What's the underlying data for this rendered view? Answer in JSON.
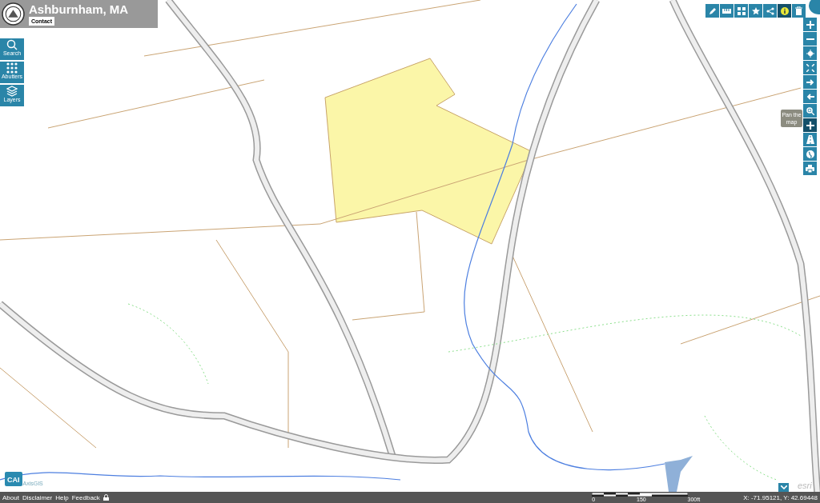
{
  "header": {
    "title": "Ashburnham, MA",
    "contact_button": "Contact"
  },
  "left_tools": [
    {
      "kind": "search",
      "label": "Search"
    },
    {
      "kind": "abutters",
      "label": "Abutters"
    },
    {
      "kind": "layers",
      "label": "Layers"
    }
  ],
  "top_tools": [
    {
      "kind": "pencil",
      "selected": false
    },
    {
      "kind": "ruler",
      "selected": false
    },
    {
      "kind": "grid",
      "selected": false
    },
    {
      "kind": "star",
      "selected": false
    },
    {
      "kind": "share",
      "selected": false
    },
    {
      "kind": "info",
      "selected": true
    },
    {
      "kind": "trash",
      "selected": false
    }
  ],
  "right_tools": [
    {
      "kind": "plus",
      "selected": false
    },
    {
      "kind": "minus",
      "selected": false
    },
    {
      "kind": "locate",
      "selected": false
    },
    {
      "kind": "extent",
      "selected": false
    },
    {
      "kind": "forward",
      "selected": false
    },
    {
      "kind": "back",
      "selected": false
    },
    {
      "kind": "zoom",
      "selected": false
    },
    {
      "kind": "pan",
      "selected": true
    },
    {
      "kind": "road",
      "selected": false
    },
    {
      "kind": "globe",
      "selected": false
    },
    {
      "kind": "print",
      "selected": false
    }
  ],
  "tooltip": "Pan the map",
  "logo": {
    "brand": "CAI",
    "product": "AxisGIS"
  },
  "attribution": "esri",
  "footer": {
    "links": [
      "About",
      "Disclaimer",
      "Help",
      "Feedback"
    ],
    "scale_labels": [
      "0",
      "150",
      "300ft"
    ],
    "coordinates": "X: -71.95121, Y: 42.69448"
  }
}
